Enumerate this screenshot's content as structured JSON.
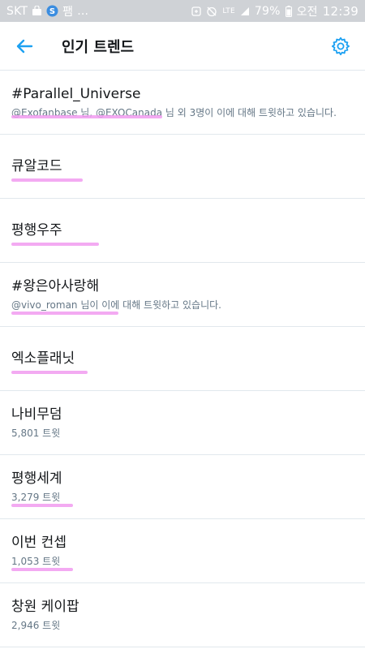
{
  "status_bar": {
    "carrier": "SKT",
    "app_glyph": "팸",
    "ellipsis": "...",
    "network": "LTE",
    "battery": "79%",
    "ampm": "오전",
    "time": "12:39"
  },
  "header": {
    "title": "인기 트렌드"
  },
  "colors": {
    "accent": "#1da1f2",
    "highlight": "#f19bf0",
    "meta_text": "#657786"
  },
  "trends": [
    {
      "name": "#Parallel_Universe",
      "mention1": "@Exofanbase",
      "sep": " 님, ",
      "mention2": "@EXOCanada",
      "suffix": " 님 외 3명이 이에 대해 트윗하고 있습니다."
    },
    {
      "name": "큐알코드"
    },
    {
      "name": "평행우주"
    },
    {
      "name": "#왕은아사랑해",
      "mention1": "@vivo_roman",
      "suffix": " 님이 이에 대해 트윗하고 있습니다."
    },
    {
      "name": "엑소플래닛"
    },
    {
      "name": "나비무덤",
      "count": "5,801 트윗"
    },
    {
      "name": "평행세계",
      "count": "3,279 트윗"
    },
    {
      "name": "이번 컨셉",
      "count": "1,053 트윗"
    },
    {
      "name": "창원 케이팝",
      "count": "2,946 트윗"
    }
  ]
}
